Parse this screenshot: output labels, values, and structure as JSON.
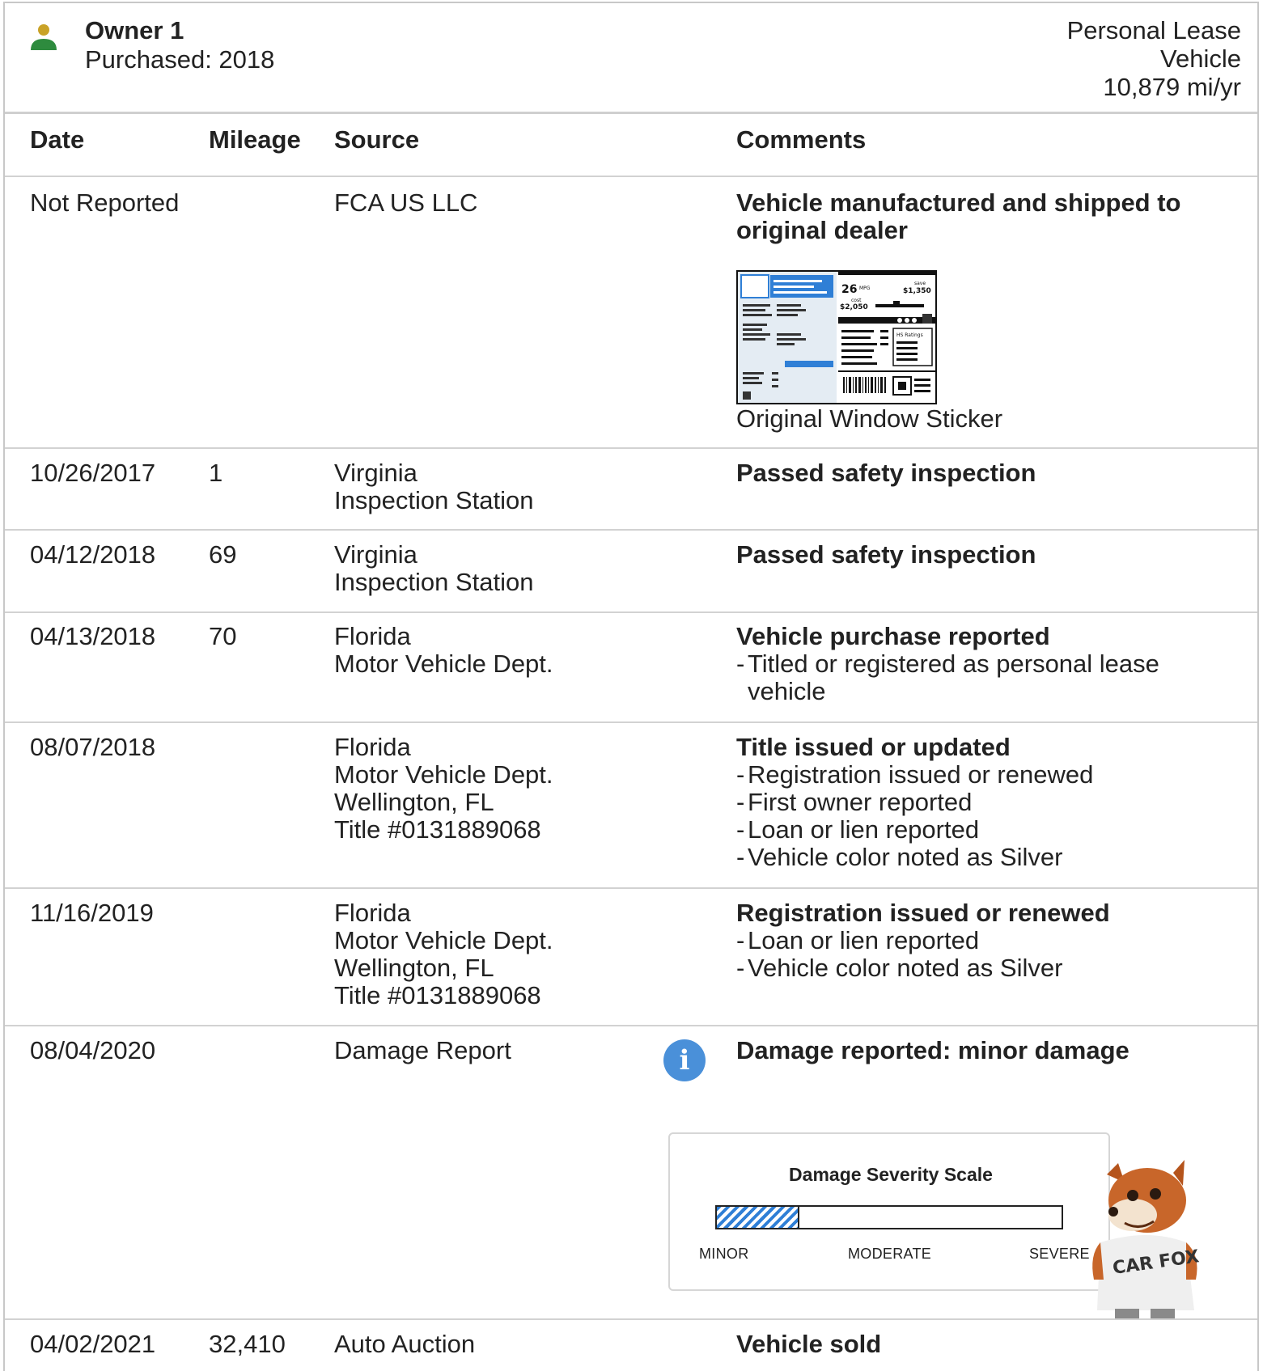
{
  "owner": {
    "title": "Owner 1",
    "purchased": "Purchased: 2018",
    "type_line1": "Personal Lease",
    "type_line2": "Vehicle",
    "mileage_rate": "10,879 mi/yr",
    "icon": "person-icon"
  },
  "columns": {
    "date": "Date",
    "mileage": "Mileage",
    "source": "Source",
    "comments": "Comments"
  },
  "records": [
    {
      "date": "Not Reported",
      "mileage": "",
      "source": [
        "FCA US LLC"
      ],
      "comment_title": "Vehicle manufactured and shipped to original dealer",
      "comment_items": [],
      "attachment": {
        "label": "Original Window Sticker",
        "sticker_text": {
          "mpg": "26",
          "mpg_unit": "MPG",
          "save": "save",
          "save_amount": "$1,350",
          "cost": "cost",
          "cost_amount": "$2,050",
          "ratings": "HS Ratings"
        }
      }
    },
    {
      "date": "10/26/2017",
      "mileage": "1",
      "source": [
        "Virginia",
        "Inspection Station"
      ],
      "comment_title": "Passed safety inspection",
      "comment_items": []
    },
    {
      "date": "04/12/2018",
      "mileage": "69",
      "source": [
        "Virginia",
        "Inspection Station"
      ],
      "comment_title": "Passed safety inspection",
      "comment_items": []
    },
    {
      "date": "04/13/2018",
      "mileage": "70",
      "source": [
        "Florida",
        "Motor Vehicle Dept."
      ],
      "comment_title": "Vehicle purchase reported",
      "comment_items": [
        "Titled or registered as personal lease",
        "vehicle"
      ]
    },
    {
      "date": "08/07/2018",
      "mileage": "",
      "source": [
        "Florida",
        "Motor Vehicle Dept.",
        "Wellington, FL",
        "Title #0131889068"
      ],
      "comment_title": "Title issued or updated",
      "comment_items": [
        "Registration issued or renewed",
        "First owner reported",
        "Loan or lien reported",
        "Vehicle color noted as Silver"
      ]
    },
    {
      "date": "11/16/2019",
      "mileage": "",
      "source": [
        "Florida",
        "Motor Vehicle Dept.",
        "Wellington, FL",
        "Title #0131889068"
      ],
      "comment_title": "Registration issued or renewed",
      "comment_items": [
        "Loan or lien reported",
        "Vehicle color noted as Silver"
      ]
    },
    {
      "date": "08/04/2020",
      "mileage": "",
      "source": [
        "Damage Report"
      ],
      "comment_title": "Damage reported: minor damage",
      "comment_items": [],
      "info_icon": "info-icon",
      "severity": {
        "title": "Damage Severity Scale",
        "level_fraction": 0.24,
        "fill_color": "#2f7fd6",
        "labels": {
          "minor": "MINOR",
          "moderate": "MODERATE",
          "severe": "SEVERE"
        },
        "mascot_text": "CAR FOX"
      }
    },
    {
      "date": "04/02/2021",
      "mileage": "32,410",
      "source": [
        "Auto Auction"
      ],
      "comment_title": "Vehicle sold",
      "comment_items": []
    }
  ]
}
